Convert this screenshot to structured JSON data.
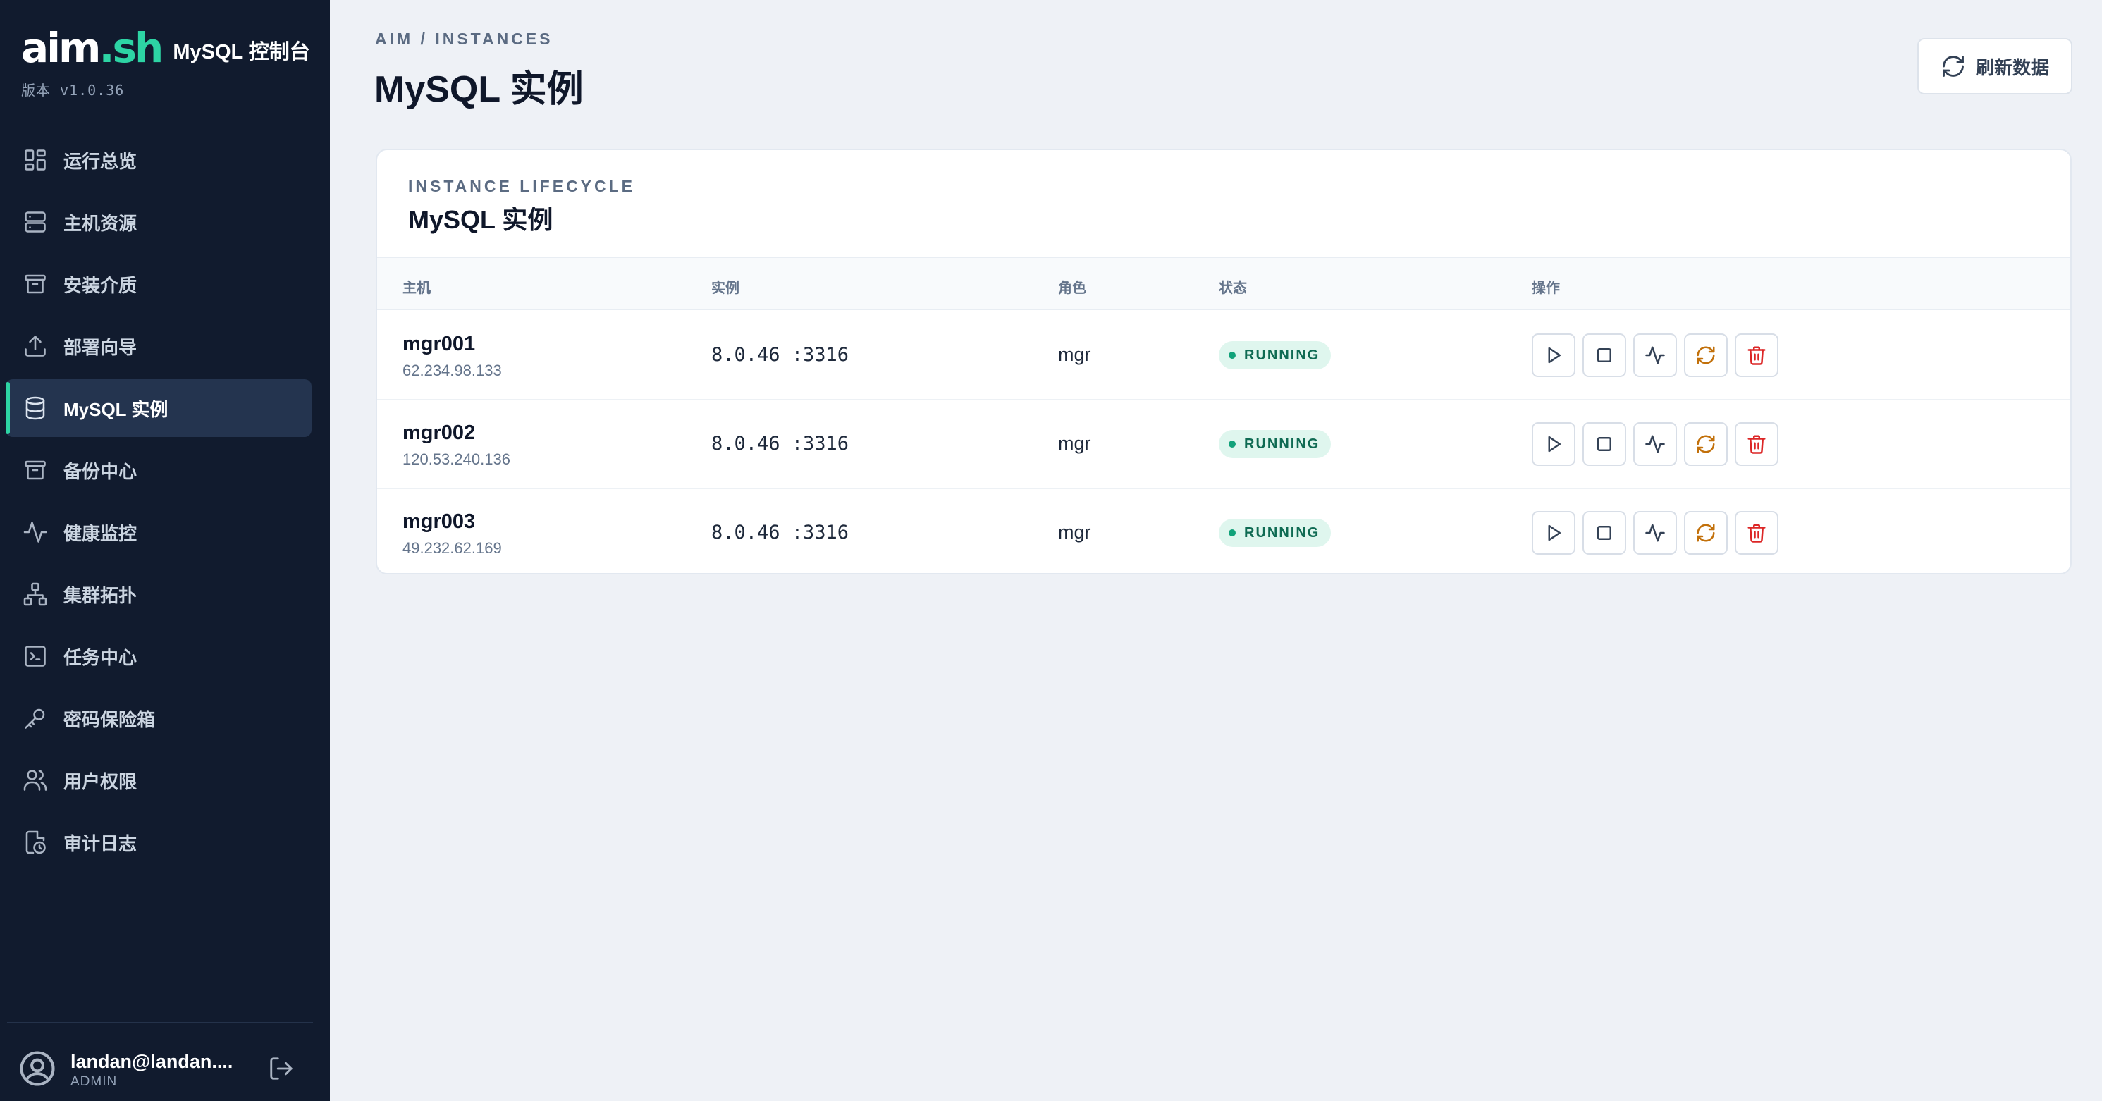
{
  "app": {
    "logo_main": "aim",
    "logo_dot": ".",
    "logo_suffix": "sh",
    "title": "MySQL 控制台",
    "version": "版本 v1.0.36"
  },
  "sidebar": {
    "items": [
      {
        "label": "运行总览",
        "icon": "dashboard-grid-icon"
      },
      {
        "label": "主机资源",
        "icon": "server-icon"
      },
      {
        "label": "安装介质",
        "icon": "archive-box-icon"
      },
      {
        "label": "部署向导",
        "icon": "upload-tray-icon"
      },
      {
        "label": "MySQL 实例",
        "icon": "database-icon",
        "active": true
      },
      {
        "label": "备份中心",
        "icon": "archive-box-icon"
      },
      {
        "label": "健康监控",
        "icon": "pulse-icon"
      },
      {
        "label": "集群拓扑",
        "icon": "network-tree-icon"
      },
      {
        "label": "任务中心",
        "icon": "terminal-icon"
      },
      {
        "label": "密码保险箱",
        "icon": "key-icon"
      },
      {
        "label": "用户权限",
        "icon": "users-icon"
      },
      {
        "label": "审计日志",
        "icon": "file-clock-icon"
      }
    ],
    "user": {
      "name": "landan@landan....",
      "role": "ADMIN"
    }
  },
  "header": {
    "breadcrumb": "AIM / INSTANCES",
    "title": "MySQL 实例",
    "refresh_label": "刷新数据"
  },
  "card": {
    "kicker": "INSTANCE LIFECYCLE",
    "title": "MySQL 实例",
    "columns": [
      "主机",
      "实例",
      "角色",
      "状态",
      "操作"
    ],
    "rows": [
      {
        "host": "mgr001",
        "ip": "62.234.98.133",
        "instance": "8.0.46 :3316",
        "role": "mgr",
        "status": "RUNNING"
      },
      {
        "host": "mgr002",
        "ip": "120.53.240.136",
        "instance": "8.0.46 :3316",
        "role": "mgr",
        "status": "RUNNING"
      },
      {
        "host": "mgr003",
        "ip": "49.232.62.169",
        "instance": "8.0.46 :3316",
        "role": "mgr",
        "status": "RUNNING"
      }
    ],
    "actions": [
      "start-icon",
      "stop-icon",
      "health-check-icon",
      "restart-icon",
      "delete-icon"
    ]
  },
  "colors": {
    "sidebar_bg": "#111b2e",
    "accent": "#2dd4a4",
    "status_running_bg": "#dff6ee",
    "status_running_text": "#0f6b53",
    "warn": "#c2700a",
    "danger": "#dc2626"
  }
}
